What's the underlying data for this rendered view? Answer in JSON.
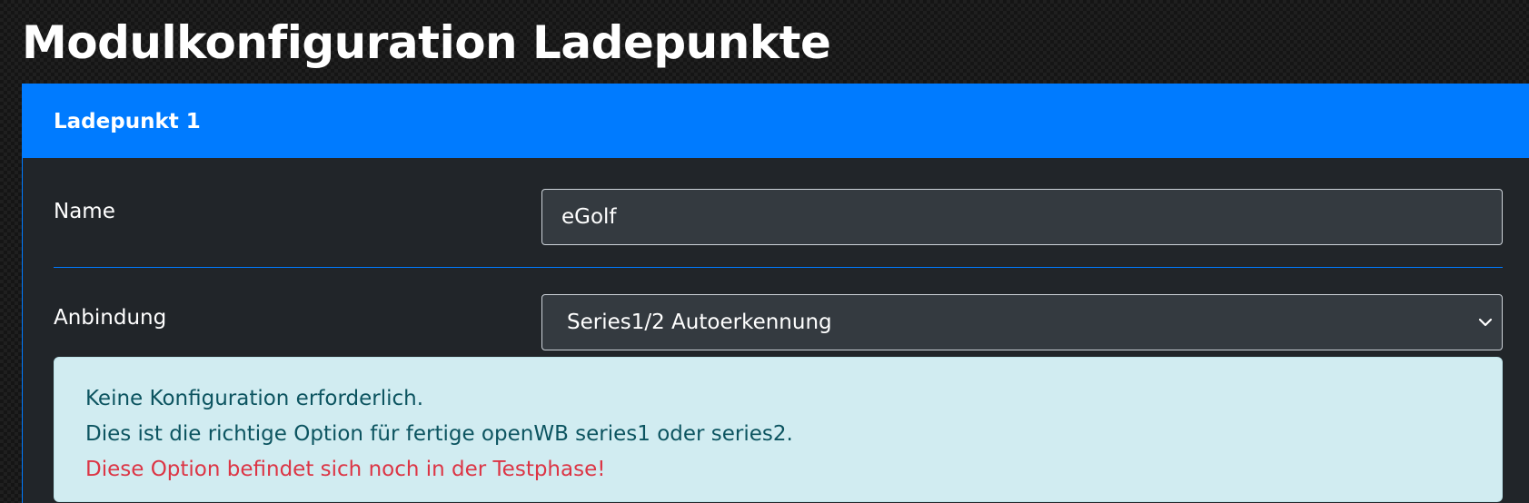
{
  "page": {
    "title": "Modulkonfiguration Ladepunkte"
  },
  "card": {
    "title": "Ladepunkt 1"
  },
  "form": {
    "name_label": "Name",
    "name_value": "eGolf",
    "connection_label": "Anbindung",
    "connection_selected": "Series1/2 Autoerkennung"
  },
  "alert": {
    "line1": "Keine Konfiguration erforderlich.",
    "line2": "Dies ist die richtige Option für fertige openWB series1 oder series2.",
    "warning": "Diese Option befindet sich noch in der Testphase!"
  },
  "icons": {
    "select_arrow": "chevron-down-icon"
  },
  "colors": {
    "accent": "#007bff",
    "card_bg": "#212529",
    "input_bg": "#343a40",
    "alert_bg": "#d1ecf1",
    "alert_text": "#0c5460",
    "warning_text": "#dc3545"
  }
}
